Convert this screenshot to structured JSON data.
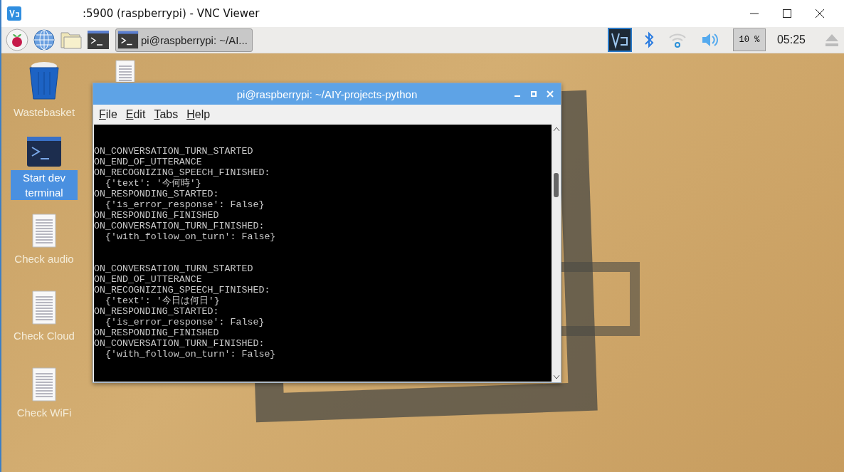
{
  "viewer_window": {
    "title": ":5900 (raspberrypi) - VNC Viewer"
  },
  "taskbar": {
    "launchers": [
      {
        "kind": "menu"
      },
      {
        "kind": "browser"
      },
      {
        "kind": "files"
      },
      {
        "kind": "terminal"
      }
    ],
    "tasks": [
      {
        "label": "pi@raspberrypi: ~/AI...",
        "selected": true
      }
    ],
    "tray": {
      "cpu": "10 %",
      "clock": "05:25"
    }
  },
  "desktop_icons": [
    {
      "label": "Wastebasket",
      "kind": "trash",
      "selected": false
    },
    {
      "label": "Start dev terminal",
      "kind": "terminal",
      "selected": true
    },
    {
      "label": "Check audio",
      "kind": "document",
      "selected": false
    },
    {
      "label": "Check Cloud",
      "kind": "document",
      "selected": false
    },
    {
      "label": "Check WiFi",
      "kind": "document",
      "selected": false
    }
  ],
  "terminal_window": {
    "title": "pi@raspberrypi: ~/AIY-projects-python",
    "menu": [
      "File",
      "Edit",
      "Tabs",
      "Help"
    ],
    "output_blocks": [
      [
        "ON_CONVERSATION_TURN_STARTED",
        "ON_END_OF_UTTERANCE",
        "ON_RECOGNIZING_SPEECH_FINISHED:",
        "  {'text': '今何時'}",
        "ON_RESPONDING_STARTED:",
        "  {'is_error_response': False}",
        "ON_RESPONDING_FINISHED",
        "ON_CONVERSATION_TURN_FINISHED:",
        "  {'with_follow_on_turn': False}"
      ],
      [
        "ON_CONVERSATION_TURN_STARTED",
        "ON_END_OF_UTTERANCE",
        "ON_RECOGNIZING_SPEECH_FINISHED:",
        "  {'text': '今日は何日'}",
        "ON_RESPONDING_STARTED:",
        "  {'is_error_response': False}",
        "ON_RESPONDING_FINISHED",
        "ON_CONVERSATION_TURN_FINISHED:",
        "  {'with_follow_on_turn': False}"
      ]
    ]
  }
}
